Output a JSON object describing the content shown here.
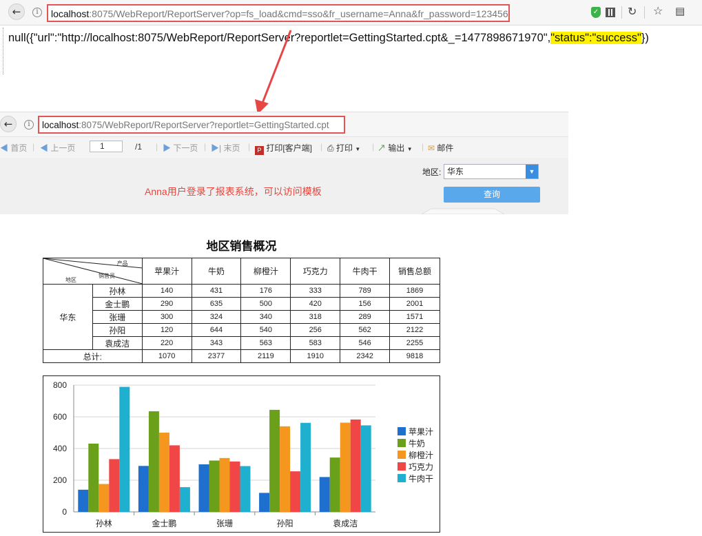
{
  "browser_top": {
    "url_host": "localhost",
    "url_rest": ":8075/WebReport/ReportServer?op=fs_load&cmd=sso&fr_username=Anna&fr_password=123456",
    "response_prefix": "null({\"url\":\"http://localhost:8075/WebReport/ReportServer?reportlet=GettingStarted.cpt&_=1477898671970\",",
    "response_status": "\"status\":\"success\"",
    "response_suffix": "})"
  },
  "browser_second": {
    "url_host": "localhost",
    "url_rest": ":8075/WebReport/ReportServer?reportlet=GettingStarted.cpt"
  },
  "report_toolbar": {
    "first": "首页",
    "prev": "上一页",
    "page_value": "1",
    "page_total": "/1",
    "next": "下一页",
    "last": "末页",
    "print_client": "打印[客户端]",
    "print": "打印",
    "export": "输出",
    "email": "邮件"
  },
  "params": {
    "region_label": "地区:",
    "region_value": "华东",
    "query_button": "查询"
  },
  "note": "Anna用户登录了报表系统，可以访问模板",
  "report": {
    "title": "地区销售概况",
    "diag_product": "产品",
    "diag_sales": "销售员",
    "diag_region": "地区",
    "headers": [
      "苹果汁",
      "牛奶",
      "柳橙汁",
      "巧克力",
      "牛肉干",
      "销售总额"
    ],
    "region": "华东",
    "rows": [
      {
        "name": "孙林",
        "vals": [
          "140",
          "431",
          "176",
          "333",
          "789",
          "1869"
        ]
      },
      {
        "name": "金士鹏",
        "vals": [
          "290",
          "635",
          "500",
          "420",
          "156",
          "2001"
        ]
      },
      {
        "name": "张珊",
        "vals": [
          "300",
          "324",
          "340",
          "318",
          "289",
          "1571"
        ]
      },
      {
        "name": "孙阳",
        "vals": [
          "120",
          "644",
          "540",
          "256",
          "562",
          "2122"
        ]
      },
      {
        "name": "袁成洁",
        "vals": [
          "220",
          "343",
          "563",
          "583",
          "546",
          "2255"
        ]
      }
    ],
    "total_label": "总计:",
    "totals": [
      "1070",
      "2377",
      "2119",
      "1910",
      "2342",
      "9818"
    ]
  },
  "chart_data": {
    "type": "bar",
    "categories": [
      "孙林",
      "金士鹏",
      "张珊",
      "孙阳",
      "袁成洁"
    ],
    "series": [
      {
        "name": "苹果汁",
        "color": "#1f6fcf",
        "values": [
          140,
          290,
          300,
          120,
          220
        ]
      },
      {
        "name": "牛奶",
        "color": "#6aa01a",
        "values": [
          431,
          635,
          324,
          644,
          343
        ]
      },
      {
        "name": "柳橙汁",
        "color": "#f5961e",
        "values": [
          176,
          500,
          340,
          540,
          563
        ]
      },
      {
        "name": "巧克力",
        "color": "#f04646",
        "values": [
          333,
          420,
          318,
          256,
          583
        ]
      },
      {
        "name": "牛肉干",
        "color": "#1fb0cf",
        "values": [
          789,
          156,
          289,
          562,
          546
        ]
      }
    ],
    "ylim": [
      0,
      800
    ],
    "yticks": [
      0,
      200,
      400,
      600,
      800
    ],
    "grid": true,
    "legend": "right"
  }
}
